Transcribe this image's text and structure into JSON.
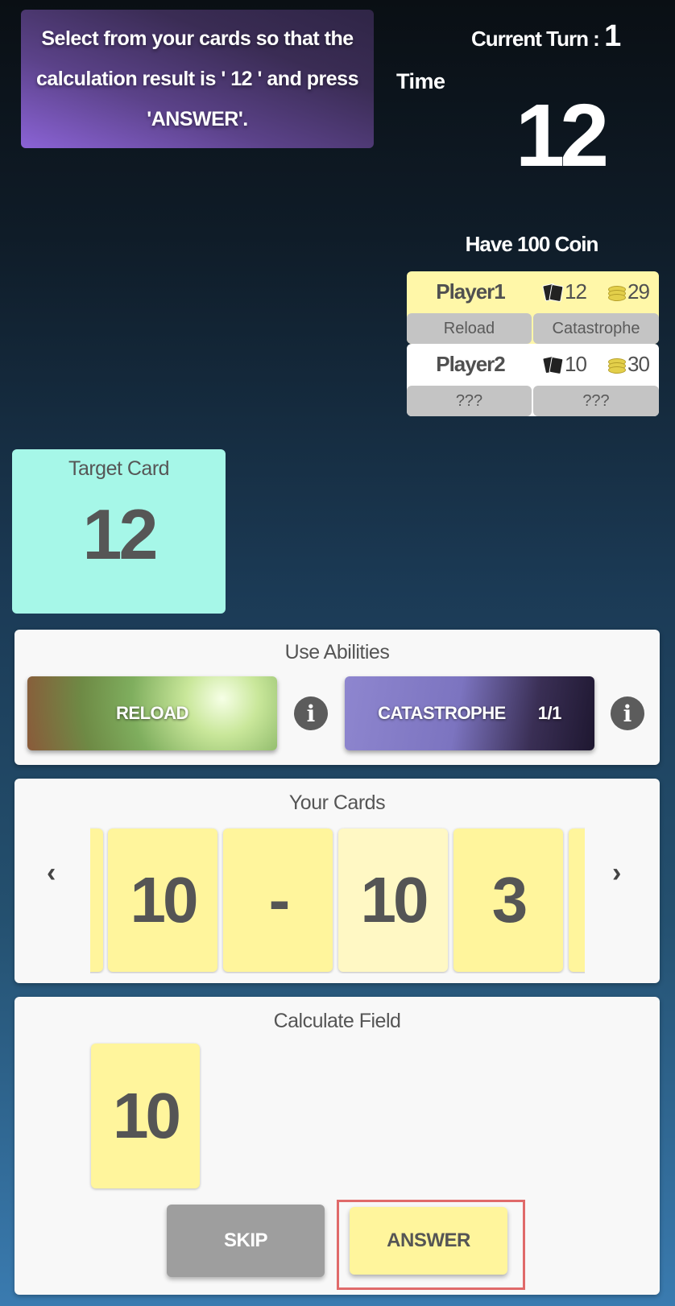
{
  "instruction": "Select from your cards so that the calculation result is ' 12 ' and press 'ANSWER'.",
  "turn": {
    "label": "Current Turn :",
    "value": "1"
  },
  "time": {
    "label": "Time",
    "value": "12"
  },
  "coin_text": "Have 100 Coin",
  "players": [
    {
      "name": "Player1",
      "cards": "12",
      "coins": "29",
      "ability_left": "Reload",
      "ability_right": "Catastrophe",
      "bg": "#fff7a8"
    },
    {
      "name": "Player2",
      "cards": "10",
      "coins": "30",
      "ability_left": "???",
      "ability_right": "???",
      "bg": "#ffffff"
    }
  ],
  "target": {
    "label": "Target Card",
    "value": "12"
  },
  "abilities": {
    "title": "Use Abilities",
    "reload_label": "RELOAD",
    "catastrophe_label": "CATASTROPHE",
    "catastrophe_count": "1/1"
  },
  "your_cards": {
    "title": "Your Cards",
    "cards": [
      "10",
      "-",
      "10",
      "3"
    ]
  },
  "calc": {
    "title": "Calculate Field",
    "cards": [
      "10"
    ]
  },
  "buttons": {
    "skip": "SKIP",
    "answer": "ANSWER"
  },
  "colors": {
    "card_yellow": "#fff59c",
    "target_bg": "#a6f7e8",
    "skip_bg": "#9e9e9e"
  }
}
